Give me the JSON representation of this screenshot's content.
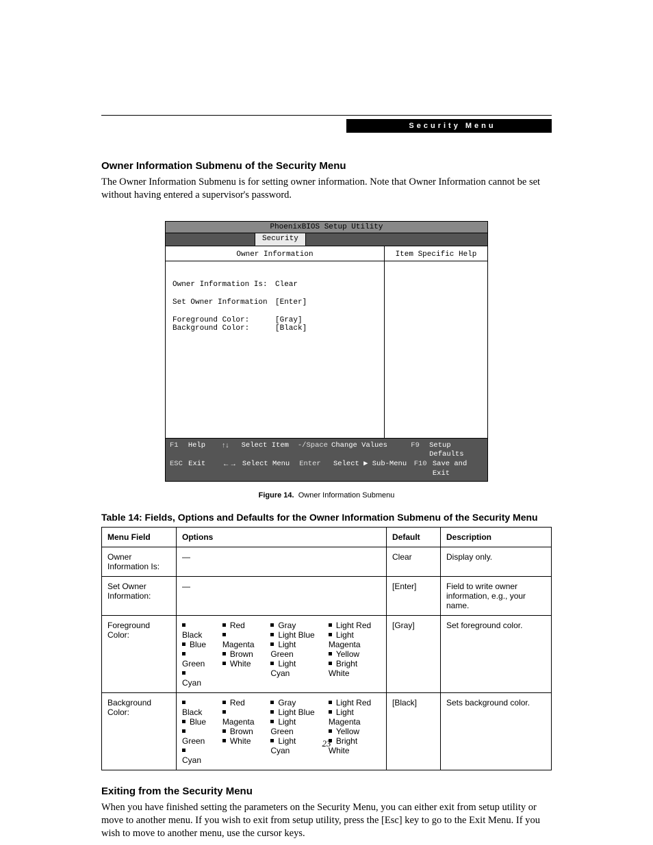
{
  "header": {
    "breadcrumb": "Security Menu"
  },
  "sec1": {
    "title": "Owner Information Submenu of the Security Menu",
    "para": "The Owner Information Submenu is for setting owner information. Note that Owner Information cannot be set without having entered a supervisor's password."
  },
  "bios": {
    "utility_title": "PhoenixBIOS Setup Utility",
    "tab": "Security",
    "panel_title": "Owner Information",
    "help_title": "Item Specific Help",
    "rows": {
      "r1": {
        "label": "Owner Information Is:",
        "value": "Clear"
      },
      "r2": {
        "label": "Set Owner Information",
        "value": "[Enter]"
      },
      "r3": {
        "label": "Foreground Color:",
        "value": "[Gray]"
      },
      "r4": {
        "label": "Background Color:",
        "value": "[Black]"
      }
    },
    "footer": {
      "f1": {
        "key": "F1",
        "act": "Help"
      },
      "ud": {
        "key": "↑↓",
        "act": "Select Item"
      },
      "ms": {
        "key": "-/Space",
        "act": "Change Values"
      },
      "f9": {
        "key": "F9",
        "act": "Setup Defaults"
      },
      "esc": {
        "key": "ESC",
        "act": "Exit"
      },
      "lr": {
        "key": "←→",
        "act": "Select Menu"
      },
      "en": {
        "key": "Enter",
        "act": "Select ▶ Sub-Menu"
      },
      "f10": {
        "key": "F10",
        "act": "Save and Exit"
      }
    }
  },
  "figure": {
    "label": "Figure 14.",
    "caption": "Owner Information Submenu"
  },
  "table": {
    "title": "Table 14: Fields, Options and Defaults for the Owner Information Submenu of the Security Menu",
    "head": {
      "c1": "Menu Field",
      "c2": "Options",
      "c3": "Default",
      "c4": "Description"
    },
    "rows": [
      {
        "field": "Owner Information Is:",
        "options_dash": "—",
        "default": "Clear",
        "desc": "Display only."
      },
      {
        "field": "Set Owner Information:",
        "options_dash": "—",
        "default": "[Enter]",
        "desc": "Field to write owner information, e.g., your name."
      },
      {
        "field": "Foreground Color:",
        "default": "[Gray]",
        "desc": "Set foreground color."
      },
      {
        "field": "Background Color:",
        "default": "[Black]",
        "desc": "Sets background color."
      }
    ],
    "color_options": {
      "col1": [
        "Black",
        "Blue",
        "Green",
        "Cyan"
      ],
      "col2": [
        "Red",
        "Magenta",
        "Brown",
        "White"
      ],
      "col3": [
        "Gray",
        "Light Blue",
        "Light Green",
        "Light Cyan"
      ],
      "col4": [
        "Light Red",
        "Light Magenta",
        "Yellow",
        "Bright White"
      ]
    }
  },
  "sec2": {
    "title": "Exiting from the Security Menu",
    "para": "When you have finished setting the parameters on the Security Menu, you can either exit from setup utility or move to another menu. If you wish to exit from setup utility, press the [Esc] key to go to the Exit Menu. If you wish to move to another menu, use the cursor keys."
  },
  "page_number": "23"
}
